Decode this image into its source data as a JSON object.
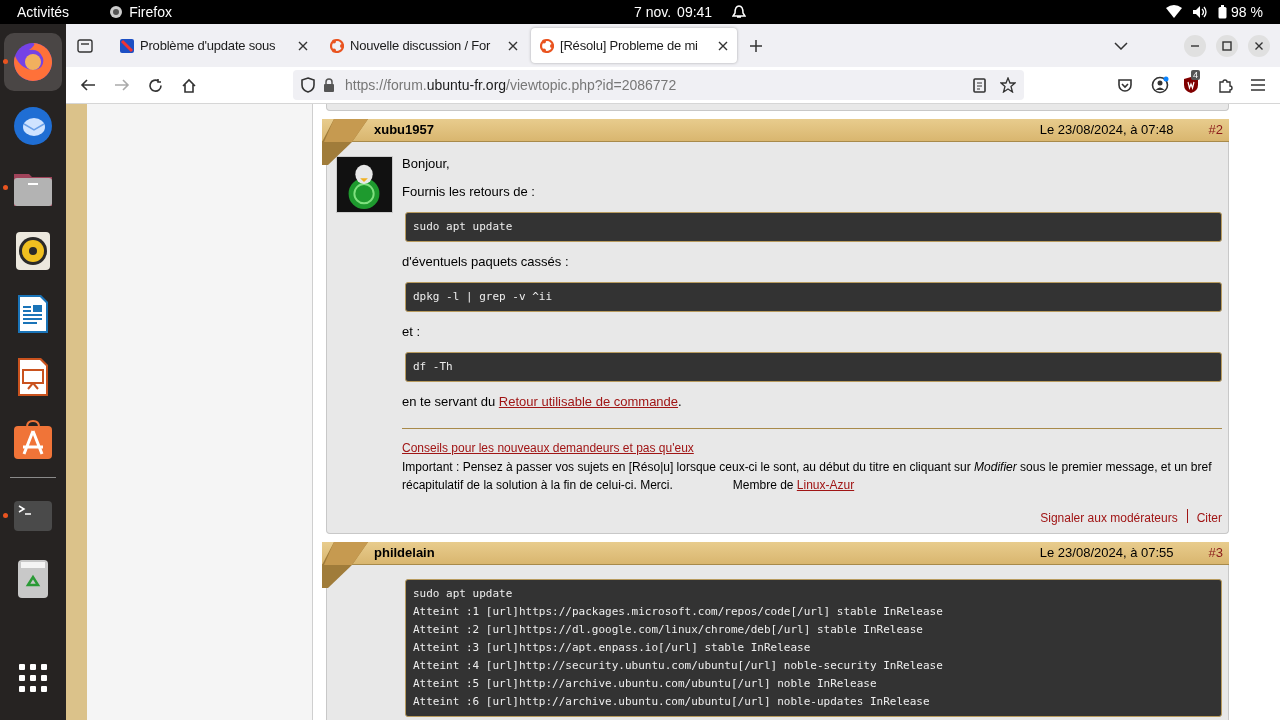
{
  "top_bar": {
    "activities": "Activités",
    "app_name": "Firefox",
    "date": "7 nov.",
    "time": "09:41",
    "battery": "98 %"
  },
  "dock": [
    {
      "kind": "firefox",
      "running": true,
      "selected": true
    },
    {
      "kind": "mail",
      "running": false,
      "selected": false
    },
    {
      "kind": "files",
      "running": true,
      "selected": false
    },
    {
      "kind": "music",
      "running": false,
      "selected": false
    },
    {
      "kind": "writer",
      "running": false,
      "selected": false
    },
    {
      "kind": "impress",
      "running": false,
      "selected": false
    },
    {
      "kind": "store",
      "running": false,
      "selected": false
    },
    {
      "kind": "separator"
    },
    {
      "kind": "terminal",
      "running": true,
      "selected": false
    },
    {
      "kind": "trash",
      "running": false,
      "selected": false
    },
    {
      "kind": "apps"
    }
  ],
  "tabs": [
    {
      "title": "Problème d'update sous",
      "selected": false
    },
    {
      "title": "Nouvelle discussion / For",
      "selected": false
    },
    {
      "title": "[Résolu] Probleme de mi",
      "selected": true
    }
  ],
  "url": {
    "prefix": "https://forum.",
    "domain": "ubuntu-fr.org",
    "path": "/viewtopic.php?id=2086772"
  },
  "extension_badge": "4",
  "posts": [
    {
      "author": "xubu1957",
      "date": "Le 23/08/2024, à 07:48",
      "number": "#2",
      "avatar": true,
      "body": [
        {
          "kind": "paragraph",
          "text": "Bonjour,"
        },
        {
          "kind": "paragraph",
          "text": "Fournis les retours de :"
        },
        {
          "kind": "code",
          "lines": [
            "sudo apt update"
          ]
        },
        {
          "kind": "paragraph",
          "text": "d'éventuels paquets cassés :"
        },
        {
          "kind": "code",
          "lines": [
            "dpkg -l | grep -v ^ii"
          ]
        },
        {
          "kind": "paragraph",
          "text": "et :"
        },
        {
          "kind": "code",
          "lines": [
            "df -Th"
          ]
        },
        {
          "kind": "paragraph",
          "text": "en te servant du ",
          "link": "Retour utilisable de commande",
          "after": "."
        }
      ],
      "signature": {
        "link": "Conseils pour les nouveaux demandeurs et pas qu'eux",
        "text": "Important : Pensez à passer vos sujets en [Réso|u] lorsque ceux-ci le sont, au début du titre en cliquant sur *Modifier* sous le premier message, et un bref récapitulatif de la solution à la fin de celui-ci. Merci.",
        "member": "Membre de ",
        "member_link": "Linux-Azur"
      },
      "actions": [
        "Signaler aux modérateurs",
        "Citer"
      ]
    },
    {
      "author": "phildelain",
      "date": "Le 23/08/2024, à 07:55",
      "number": "#3",
      "avatar": false,
      "body": [
        {
          "kind": "code",
          "lines": [
            "sudo apt update",
            "Atteint :1 [url]https://packages.microsoft.com/repos/code[/url] stable InRelease",
            "Atteint :2 [url]https://dl.google.com/linux/chrome/deb[/url] stable InRelease",
            "Atteint :3 [url]https://apt.enpass.io[/url] stable InRelease",
            "Atteint :4 [url]http://security.ubuntu.com/ubuntu[/url] noble-security InRelease",
            "Atteint :5 [url]http://archive.ubuntu.com/ubuntu[/url] noble InRelease",
            "Atteint :6 [url]http://archive.ubuntu.com/ubuntu[/url] noble-updates InRelease"
          ]
        }
      ]
    }
  ]
}
